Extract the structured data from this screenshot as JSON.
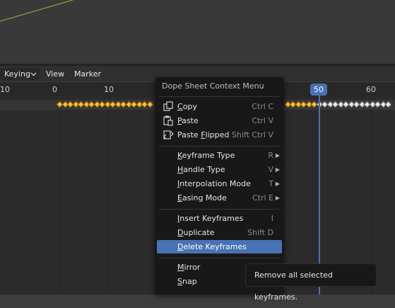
{
  "header": {
    "keying_label": "Keying",
    "view_label": "View",
    "marker_label": "Marker"
  },
  "ruler": {
    "ticks": [
      "10",
      "0",
      "10",
      "60"
    ],
    "current_frame": "50"
  },
  "context_menu": {
    "title": "Dope Sheet Context Menu",
    "items": [
      {
        "label": "Copy",
        "shortcut": "Ctrl C"
      },
      {
        "label": "Paste",
        "shortcut": "Ctrl V"
      },
      {
        "label": "Paste Flipped",
        "shortcut": "Shift Ctrl V"
      },
      {
        "label": "Keyframe Type",
        "shortcut": "R"
      },
      {
        "label": "Handle Type",
        "shortcut": "V"
      },
      {
        "label": "Interpolation Mode",
        "shortcut": "T"
      },
      {
        "label": "Easing Mode",
        "shortcut": "Ctrl E"
      },
      {
        "label": "Insert Keyframes",
        "shortcut": "I"
      },
      {
        "label": "Duplicate",
        "shortcut": "Shift D"
      },
      {
        "label": "Delete Keyframes",
        "shortcut": ""
      },
      {
        "label": "Mirror",
        "shortcut": ""
      },
      {
        "label": "Snap",
        "shortcut": ""
      }
    ]
  },
  "tooltip": {
    "text": "Remove all selected keyframes."
  },
  "colors": {
    "accent": "#4772b3",
    "keyframe_selected": "#ffbf40",
    "keyframe_unselected": "#eaeaea",
    "curve_green": "#7ea33b"
  },
  "icons": [
    "copy-icon",
    "paste-icon",
    "paste-flipped-icon",
    "chevron-down-icon",
    "submenu-arrow-icon"
  ]
}
